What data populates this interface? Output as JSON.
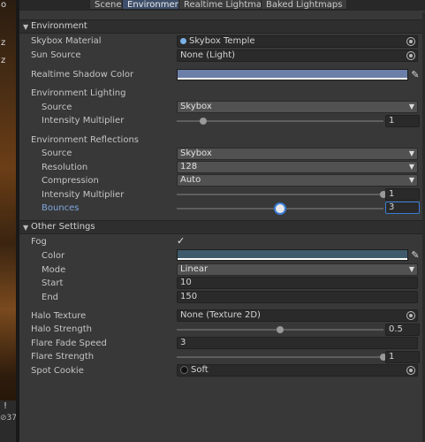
{
  "left_strip": {
    "chars": [
      "o",
      "z",
      "z"
    ],
    "bottom_icon": "!",
    "count": "37"
  },
  "tabs": [
    {
      "label": "Scene",
      "active": false
    },
    {
      "label": "Environment",
      "active": true
    },
    {
      "label": "Realtime Lightmaps",
      "active": false
    },
    {
      "label": "Baked Lightmaps",
      "active": false
    }
  ],
  "environment": {
    "header": "Environment",
    "skybox_material": {
      "label": "Skybox Material",
      "value": "Skybox Temple",
      "icon": "material-icon"
    },
    "sun_source": {
      "label": "Sun Source",
      "value": "None (Light)"
    },
    "realtime_shadow_color": {
      "label": "Realtime Shadow Color",
      "color": "#6b7fa8"
    },
    "lighting": {
      "label": "Environment Lighting",
      "source": {
        "label": "Source",
        "value": "Skybox"
      },
      "intensity": {
        "label": "Intensity Multiplier",
        "value": "1",
        "fraction": 0.13
      }
    },
    "reflections": {
      "label": "Environment Reflections",
      "source": {
        "label": "Source",
        "value": "Skybox"
      },
      "resolution": {
        "label": "Resolution",
        "value": "128"
      },
      "compression": {
        "label": "Compression",
        "value": "Auto"
      },
      "intensity": {
        "label": "Intensity Multiplier",
        "value": "1",
        "fraction": 1.0
      },
      "bounces": {
        "label": "Bounces",
        "value": "3",
        "fraction": 0.5
      }
    }
  },
  "other": {
    "header": "Other Settings",
    "fog": {
      "label": "Fog",
      "checked": true,
      "check_glyph": "✓"
    },
    "color": {
      "label": "Color",
      "color": "#3f5b6b"
    },
    "mode": {
      "label": "Mode",
      "value": "Linear"
    },
    "start": {
      "label": "Start",
      "value": "10"
    },
    "end": {
      "label": "End",
      "value": "150"
    },
    "halo_texture": {
      "label": "Halo Texture",
      "value": "None (Texture 2D)"
    },
    "halo_strength": {
      "label": "Halo Strength",
      "value": "0.5",
      "fraction": 0.5
    },
    "flare_fade_speed": {
      "label": "Flare Fade Speed",
      "value": "3"
    },
    "flare_strength": {
      "label": "Flare Strength",
      "value": "1",
      "fraction": 1.0
    },
    "spot_cookie": {
      "label": "Spot Cookie",
      "value": "Soft"
    }
  },
  "glyphs": {
    "triangle_down": "▼",
    "dropdown_arrow": "▼",
    "eyedropper": "✎"
  }
}
